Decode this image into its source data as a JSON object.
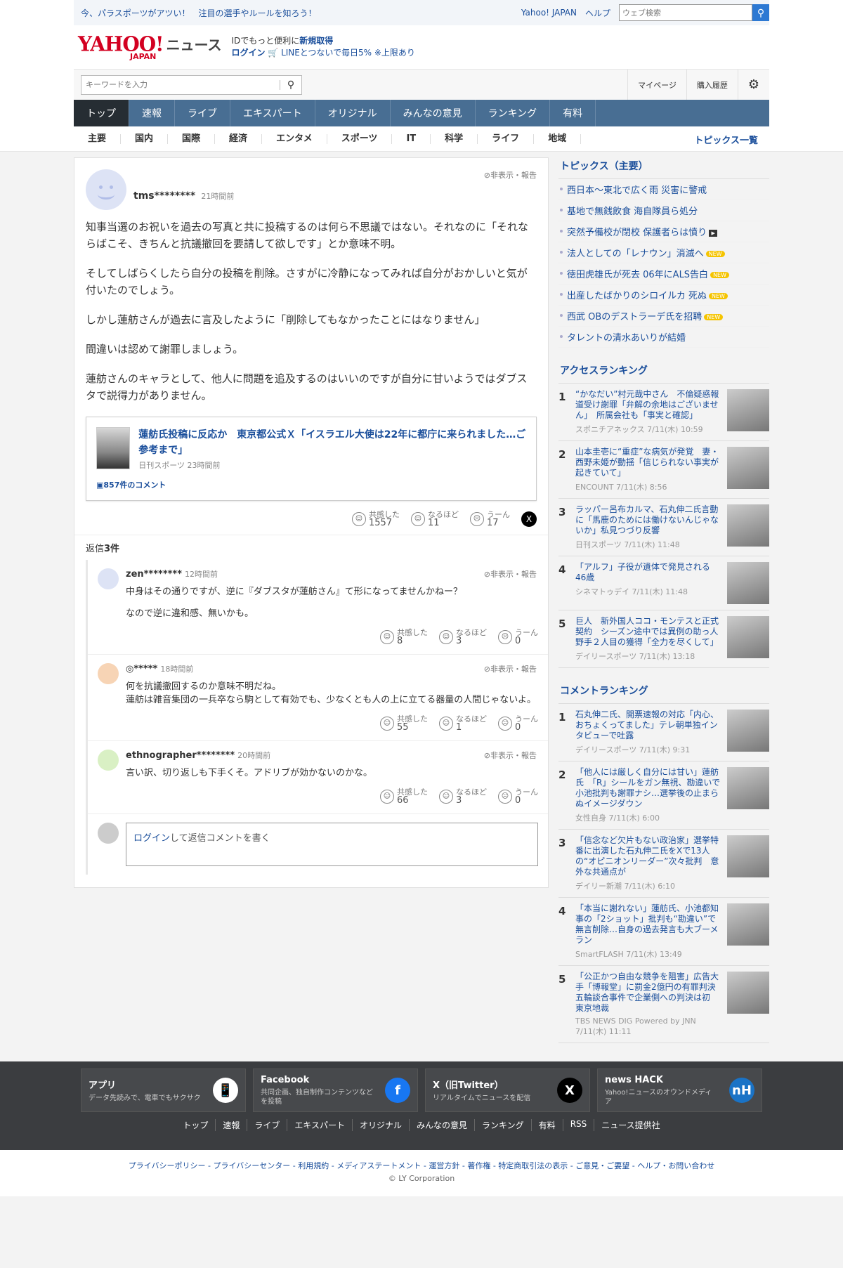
{
  "topbar": {
    "promo": "今、パラスポーツがアツい！　注目の選手やルールを知ろう！",
    "yahoo_link": "Yahoo! JAPAN",
    "help_link": "ヘルプ",
    "search_placeholder": "ウェブ検索"
  },
  "brand": {
    "logo_text": "YAHOO!",
    "logo_sub": "JAPAN",
    "news_label": "ニュース",
    "promo_line1_prefix": "IDでもっと便利に",
    "promo_line1_link": "新規取得",
    "promo_line2_login": "ログイン",
    "promo_line2_text": "LINEとつないで毎日5% ※上限あり"
  },
  "search": {
    "placeholder": "キーワードを入力",
    "mypage": "マイページ",
    "history": "購入履歴"
  },
  "nav": {
    "tabs": [
      "トップ",
      "速報",
      "ライブ",
      "エキスパート",
      "オリジナル",
      "みんなの意見",
      "ランキング",
      "有料"
    ],
    "categories": [
      "主要",
      "国内",
      "国際",
      "経済",
      "エンタメ",
      "スポーツ",
      "IT",
      "科学",
      "ライフ",
      "地域"
    ],
    "all_topics": "トピックス一覧"
  },
  "comment": {
    "user": "tms********",
    "time": "21時間前",
    "report": "非表示・報告",
    "paragraphs": [
      "知事当選のお祝いを過去の写真と共に投稿するのは何ら不思議ではない。それなのに「それならばこそ、きちんと抗議撤回を要請して欲しです」とか意味不明。",
      "そしてしばらくしたら自分の投稿を削除。さすがに冷静になってみれば自分がおかしいと気が付いたのでしょう。",
      "しかし蓮舫さんが過去に言及したように「削除してもなかったことにはなりません」",
      "間違いは認めて謝罪しましょう。",
      "蓮舫さんのキャラとして、他人に問題を追及するのはいいのですが自分に甘いようではダブスタで説得力がありません。"
    ],
    "article": {
      "title": "蓮舫氏投稿に反応か　東京都公式Ｘ「イスラエル大使は22年に都庁に来られました…ご参考まで」",
      "source": "日刊スポーツ 23時間前",
      "comments": "857件のコメント"
    },
    "reactions": [
      {
        "label": "共感した",
        "count": "1557"
      },
      {
        "label": "なるほど",
        "count": "11"
      },
      {
        "label": "うーん",
        "count": "17"
      }
    ],
    "share_x": "X",
    "reply_count_prefix": "返信",
    "reply_count": "3件"
  },
  "replies": [
    {
      "user": "zen********",
      "time": "12時間前",
      "paragraphs": [
        "中身はその通りですが、逆に『ダブスタが蓮舫さん』て形になってませんかねー？",
        "なので逆に違和感、無いかも。"
      ],
      "reactions": [
        "8",
        "3",
        "0"
      ],
      "avatar_color": "#dde3f5"
    },
    {
      "user": "◎*****",
      "time": "18時間前",
      "paragraphs": [
        "何を抗議撤回するのか意味不明だね。\n蓮舫は雑音集団の一兵卒なら駒として有効でも、少なくとも人の上に立てる器量の人間じゃないよ。"
      ],
      "reactions": [
        "55",
        "1",
        "0"
      ],
      "avatar_color": "#f7d4b5"
    },
    {
      "user": "ethnographer********",
      "time": "20時間前",
      "paragraphs": [
        "言い訳、切り返しも下手くそ。アドリブが効かないのかな。"
      ],
      "reactions": [
        "66",
        "3",
        "0"
      ],
      "avatar_color": "#d9f0c4"
    }
  ],
  "reaction_labels": [
    "共感した",
    "なるほど",
    "うーん"
  ],
  "login_reply": {
    "login": "ログイン",
    "text": "して返信コメントを書く"
  },
  "topics": {
    "heading": "トピックス（主要）",
    "items": [
      {
        "text": "西日本～東北で広く雨 災害に警戒",
        "badge": ""
      },
      {
        "text": "基地で無銭飲食 海自隊員ら処分",
        "badge": ""
      },
      {
        "text": "突然予備校が閉校 保護者らは憤り",
        "badge": "video"
      },
      {
        "text": "法人としての「レナウン」消滅へ",
        "badge": "NEW"
      },
      {
        "text": "徳田虎雄氏が死去 06年にALS告白",
        "badge": "NEW"
      },
      {
        "text": "出産したばかりのシロイルカ 死ぬ",
        "badge": "NEW"
      },
      {
        "text": "西武 OBのデストラーデ氏を招聘",
        "badge": "NEW"
      },
      {
        "text": "タレントの清水あいりが結婚",
        "badge": ""
      }
    ]
  },
  "access_ranking": {
    "heading": "アクセスランキング",
    "items": [
      {
        "n": "1",
        "title": "“かなだい”村元哉中さん　不倫疑惑報道受け謝罪「弁解の余地はございません」　所属会社も「事実と確認」",
        "source": "スポニチアネックス 7/11(木) 10:59"
      },
      {
        "n": "2",
        "title": "山本圭壱に“重症”な病気が発覚　妻・西野未姫が動揺「信じられない事実が起きていて」",
        "source": "ENCOUNT 7/11(木) 8:56"
      },
      {
        "n": "3",
        "title": "ラッパー呂布カルマ、石丸伸二氏言動に「馬鹿のためには働けないんじゃないか」私見つづり反響",
        "source": "日刊スポーツ 7/11(木) 11:48"
      },
      {
        "n": "4",
        "title": "「アルフ」子役が遺体で発見される　46歳",
        "source": "シネマトゥデイ 7/11(木) 11:48"
      },
      {
        "n": "5",
        "title": "巨人　新外国人ココ・モンテスと正式契約　シーズン途中では異例の助っ人野手２人目の獲得「全力を尽くして」",
        "source": "デイリースポーツ 7/11(木) 13:18"
      }
    ]
  },
  "comment_ranking": {
    "heading": "コメントランキング",
    "items": [
      {
        "n": "1",
        "title": "石丸伸二氏、開票速報の対応「内心、おちょくってました」テレ朝単独インタビューで吐露",
        "source": "デイリースポーツ 7/11(木) 9:31"
      },
      {
        "n": "2",
        "title": "「他人には厳しく自分には甘い」蓮舫氏　「R」シールをガン無視、勘違いで小池批判も謝罪ナシ…選挙後の止まらぬイメージダウン",
        "source": "女性自身 7/11(木) 6:00"
      },
      {
        "n": "3",
        "title": "「信念など欠片もない政治家」選挙特番に出演した石丸伸二氏をXで13人の“オピニオンリーダー”次々批判　意外な共通点が",
        "source": "デイリー新潮 7/11(木) 6:10"
      },
      {
        "n": "4",
        "title": "「本当に謝れない」蓮舫氏、小池都知事の「2ショット」批判も“勘違い”で無言削除…自身の過去発言も大ブーメラン",
        "source": "SmartFLASH 7/11(木) 13:49"
      },
      {
        "n": "5",
        "title": "「公正かつ自由な競争を阻害」広告大手「博報堂」に罰金2億円の有罪判決　五輪談合事件で企業側への判決は初　東京地裁",
        "source": "TBS NEWS DIG Powered by JNN 7/11(木) 11:11"
      }
    ]
  },
  "footer": {
    "apps": [
      {
        "title": "アプリ",
        "desc": "データ先読みで、電車でもサクサク"
      },
      {
        "title": "Facebook",
        "desc": "共同企画、独自制作コンテンツなどを投稿"
      },
      {
        "title": "X（旧Twitter）",
        "desc": "リアルタイムでニュースを配信"
      },
      {
        "title": "news HACK",
        "desc": "Yahoo!ニュースのオウンドメディア"
      }
    ],
    "links": [
      "トップ",
      "速報",
      "ライブ",
      "エキスパート",
      "オリジナル",
      "みんなの意見",
      "ランキング",
      "有料",
      "RSS",
      "ニュース提供社"
    ],
    "bottom_links": "プライバシーポリシー - プライバシーセンター - 利用規約 - メディアステートメント - 運営方針 - 著作権 - 特定商取引法の表示 - ご意見・ご要望 - ヘルプ・お問い合わせ",
    "copyright": "© LY Corporation"
  },
  "colors": {
    "accent": "#1a4e9b",
    "nav_bg": "#486e93",
    "nav_active": "#262d33",
    "brand_red": "#d30021",
    "new_badge": "#f5c400"
  }
}
